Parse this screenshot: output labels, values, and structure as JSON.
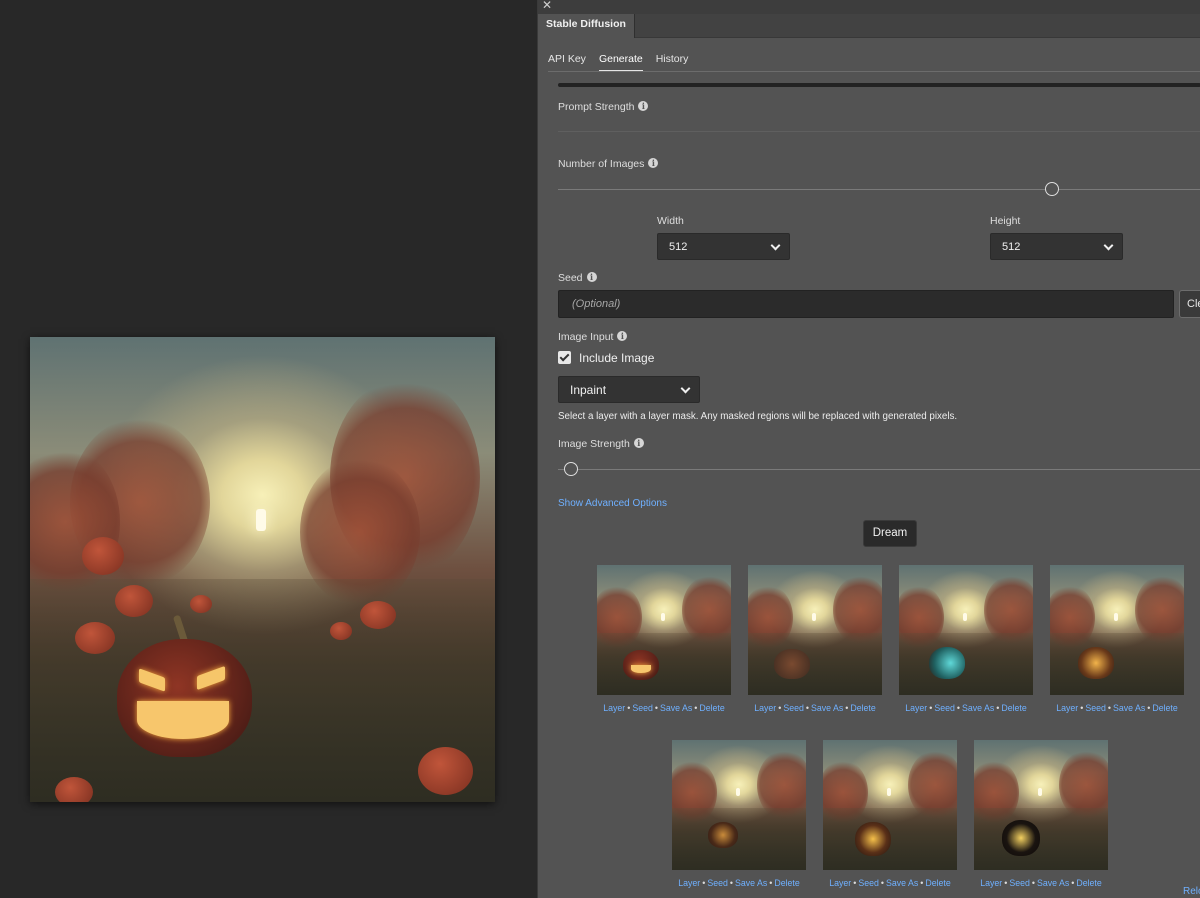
{
  "panel": {
    "title": "Stable Diffusion",
    "close_glyph": "✕"
  },
  "nav_tabs": [
    {
      "label": "API Key"
    },
    {
      "label": "Generate"
    },
    {
      "label": "History"
    }
  ],
  "active_tab": "Generate",
  "form": {
    "prompt_strength_label": "Prompt Strength",
    "num_images_label": "Number of Images",
    "width_label": "Width",
    "width_value": "512",
    "height_label": "Height",
    "height_value": "512",
    "seed_label": "Seed",
    "seed_placeholder": "(Optional)",
    "clear_label": "Cle",
    "image_input_label": "Image Input",
    "include_image_label": "Include Image",
    "include_image_checked": true,
    "mode_value": "Inpaint",
    "help_text": "Select a layer with a layer mask. Any masked regions will be replaced with generated pixels.",
    "image_strength_label": "Image Strength",
    "advanced_link": "Show Advanced Options",
    "dream_label": "Dream",
    "info_glyph": "i"
  },
  "thumb_actions": {
    "layer": "Layer",
    "seed": "Seed",
    "save_as": "Save As",
    "delete": "Delete",
    "sep": "•"
  },
  "reload_label": "Relo",
  "colors": {
    "panel_bg": "#535353",
    "canvas_bg": "#282828",
    "link": "#6fb0ff",
    "button_dark": "#2a2a2a"
  },
  "icons": {
    "info": "info-icon",
    "chevron": "chevron-down-icon",
    "close": "close-icon",
    "checkbox": "checkmark-icon"
  }
}
